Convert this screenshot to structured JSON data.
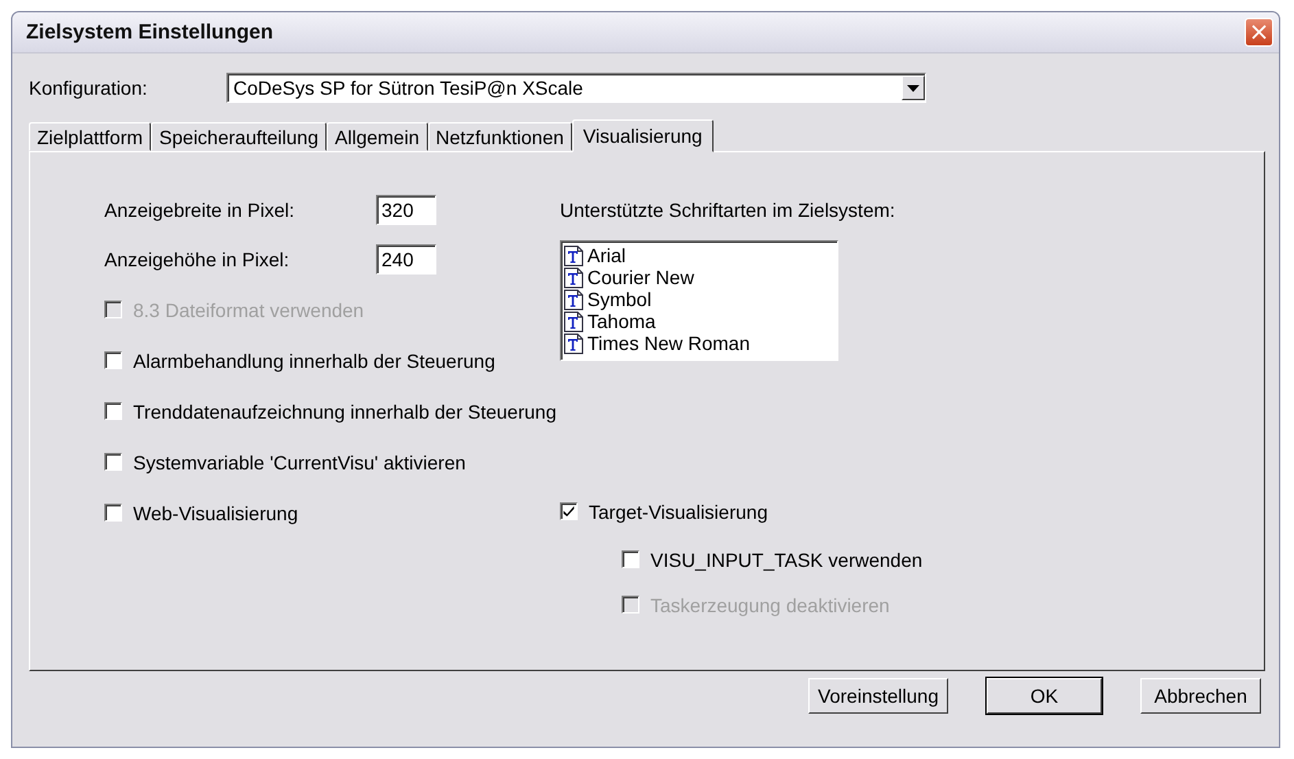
{
  "window": {
    "title": "Zielsystem Einstellungen",
    "close": "×"
  },
  "configuration": {
    "label": "Konfiguration:",
    "value": "CoDeSys SP for Sütron TesiP@n XScale"
  },
  "tabs": [
    {
      "label": "Zielplattform",
      "selected": false
    },
    {
      "label": "Speicheraufteilung",
      "selected": false
    },
    {
      "label": "Allgemein",
      "selected": false
    },
    {
      "label": "Netzfunktionen",
      "selected": false
    },
    {
      "label": "Visualisierung",
      "selected": true
    }
  ],
  "left": [
    {
      "kind": "field",
      "label": "Anzeigebreite in Pixel:",
      "value": "320"
    },
    {
      "kind": "field",
      "label": "Anzeigehöhe in Pixel:",
      "value": "240"
    },
    {
      "kind": "checkbox",
      "label": "8.3 Dateiformat verwenden",
      "checked": false,
      "disabled": true
    },
    {
      "kind": "checkbox",
      "label": "Alarmbehandlung innerhalb der Steuerung",
      "checked": false,
      "disabled": false
    },
    {
      "kind": "checkbox",
      "label": "Trenddatenaufzeichnung innerhalb der Steuerung",
      "checked": false,
      "disabled": false
    },
    {
      "kind": "checkbox",
      "label": "Systemvariable 'CurrentVisu' aktivieren",
      "checked": false,
      "disabled": false
    },
    {
      "kind": "checkbox",
      "label": "Web-Visualisierung",
      "checked": false,
      "disabled": false
    }
  ],
  "fonts": {
    "label": "Unterstützte Schriftarten im Zielsystem:",
    "items": [
      "Arial",
      "Courier New",
      "Symbol",
      "Tahoma",
      "Times New Roman"
    ]
  },
  "target": {
    "label": "Target-Visualisierung",
    "checked": true,
    "disabled": false,
    "children": [
      {
        "label": "VISU_INPUT_TASK verwenden",
        "checked": false,
        "disabled": false
      },
      {
        "label": "Taskerzeugung deaktivieren",
        "checked": false,
        "disabled": true
      }
    ]
  },
  "buttons": [
    {
      "label": "Voreinstellung",
      "default": false
    },
    {
      "label": "OK",
      "default": true
    },
    {
      "label": "Abbrechen",
      "default": false
    }
  ]
}
